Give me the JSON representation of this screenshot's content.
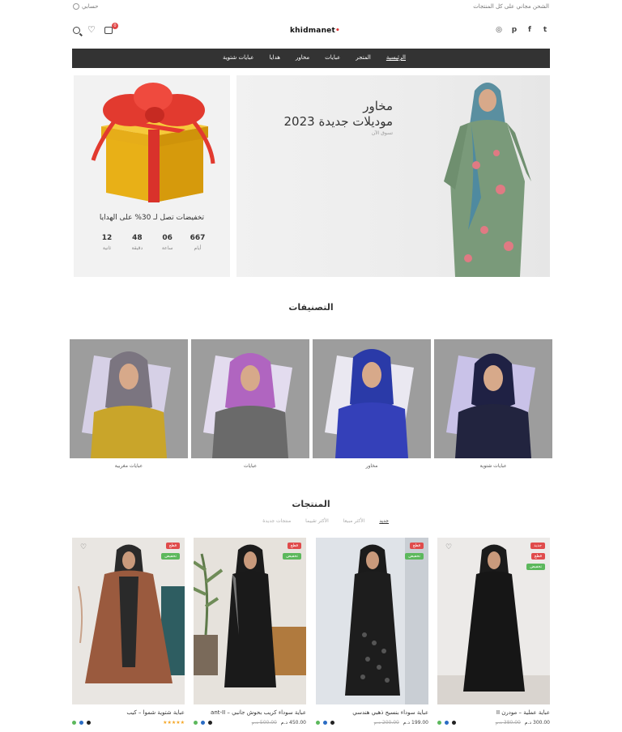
{
  "topbar": {
    "promo": "الشحن مجاني على كل المنتجات",
    "account": "حسابي"
  },
  "header": {
    "logo_text": "khidmanet",
    "logo_dot": "•",
    "cart_count": "0",
    "social": [
      {
        "icon": "twitter-icon",
        "glyph": "t"
      },
      {
        "icon": "facebook-icon",
        "glyph": "f"
      },
      {
        "icon": "pinterest-icon",
        "glyph": "p"
      },
      {
        "icon": "instagram-icon",
        "glyph": "◎"
      }
    ]
  },
  "nav": {
    "items": [
      "الرئيسية",
      "المتجر",
      "عبايات",
      "مخاور",
      "هدايا",
      "عبايات شتوية"
    ]
  },
  "promo_box": {
    "title": "تخفيضات تصل لـ 30% على الهدايا",
    "countdown": [
      {
        "value": "667",
        "label": "أيام"
      },
      {
        "value": "06",
        "label": "ساعة"
      },
      {
        "value": "48",
        "label": "دقيقة"
      },
      {
        "value": "12",
        "label": "ثانية"
      }
    ]
  },
  "hero": {
    "line1": "مخاور",
    "line2": "موديلات جديدة 2023",
    "link": "تسوق الآن"
  },
  "categories": {
    "title": "التصنيفات",
    "items": [
      {
        "label": "عبايات شتوية"
      },
      {
        "label": "مخاور"
      },
      {
        "label": "عبايات"
      },
      {
        "label": "عبايات مغربية"
      }
    ]
  },
  "products": {
    "title": "المنتجات",
    "tabs": [
      "جديد",
      "الأكثر مبيعا",
      "الأكثر تقييما",
      "منتجات جديدة"
    ],
    "items": [
      {
        "name": "عباية عملية – مودرن II",
        "price": "300.00 د.م",
        "old_price": "380.00 د.م",
        "tags": [
          {
            "text": "جديد",
            "color": "red"
          },
          {
            "text": "قطع",
            "color": "red"
          },
          {
            "text": "تخفيض",
            "color": "green"
          }
        ],
        "swatches": [
          "#222222",
          "#2b6cc4",
          "#5cb85c"
        ],
        "rating": ""
      },
      {
        "name": "عباية سوداء بنسيج ذهبي هندسي",
        "price": "199.00 د.م",
        "old_price": "200.00 د.م",
        "tags": [
          {
            "text": "قطع",
            "color": "red"
          },
          {
            "text": "تخفيض",
            "color": "green"
          }
        ],
        "swatches": [
          "#222222",
          "#2b6cc4",
          "#5cb85c"
        ],
        "rating": ""
      },
      {
        "name": "عباية سوداء كريب بحوش جانبي – ant-II",
        "price": "450.00 د.م",
        "old_price": "500.00 د.م",
        "tags": [
          {
            "text": "قطع",
            "color": "red"
          },
          {
            "text": "تخفيض",
            "color": "green"
          }
        ],
        "swatches": [
          "#222222",
          "#2b6cc4",
          "#5cb85c"
        ],
        "rating": ""
      },
      {
        "name": "عباية شتوية شموا – كيب",
        "price": "",
        "old_price": "",
        "tags": [
          {
            "text": "قطع",
            "color": "red"
          },
          {
            "text": "تخفيض",
            "color": "green"
          }
        ],
        "swatches": [
          "#222222",
          "#2b6cc4",
          "#5cb85c"
        ],
        "rating": "★★★★★"
      }
    ]
  }
}
